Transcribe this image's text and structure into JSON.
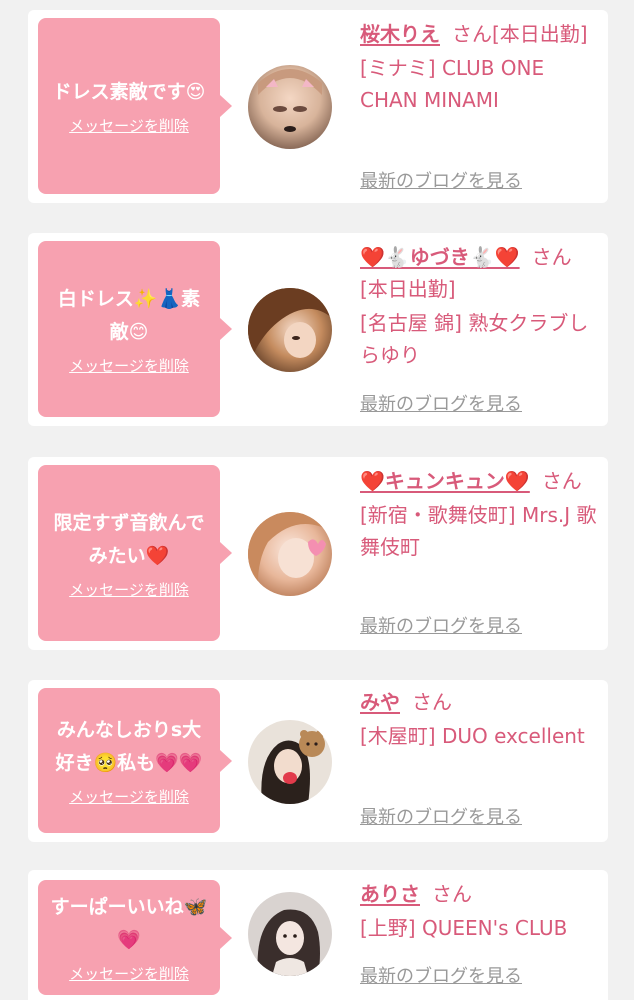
{
  "delete_label": "メッセージを削除",
  "blog_label": "最新のブログを見る",
  "cards": [
    {
      "message": "ドレス素敵です😍",
      "name": "桜木りえ",
      "honorific": "さん[本日出勤]",
      "shop": "[ミナミ] CLUB ONE CHAN MINAMI"
    },
    {
      "message": "白ドレス✨👗素敵😊",
      "name": "❤️🐇ゆづき🐇❤️",
      "honorific": "さん[本日出勤]",
      "shop": "[名古屋 錦] 熟女クラブしらゆり"
    },
    {
      "message": "限定すず音飲んでみたい❤️",
      "name": "❤️キュンキュン❤️",
      "honorific": "さん",
      "shop": "[新宿・歌舞伎町] Mrs.J 歌舞伎町"
    },
    {
      "message": "みんなしおりs大好き🥺私も💗💗",
      "name": "みや",
      "honorific": "さん",
      "shop": "[木屋町] DUO excellent"
    },
    {
      "message": "すーぱーいいね🦋💗",
      "name": "ありさ",
      "honorific": "さん",
      "shop": "[上野] QUEEN's CLUB"
    }
  ],
  "colors": {
    "page_bg": "#f1f1f1",
    "bubble_bg": "#f7a1b0",
    "accent_text": "#d85a7a",
    "link_gray": "#999999"
  }
}
